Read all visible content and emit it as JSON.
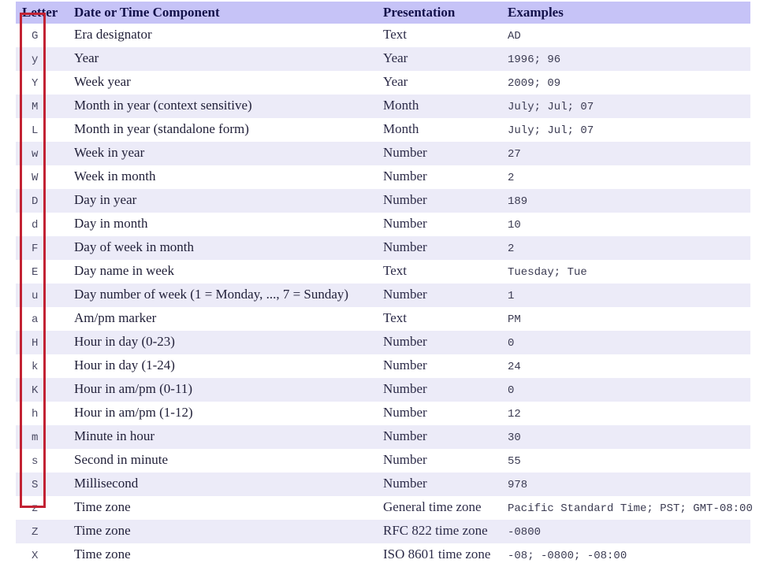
{
  "table": {
    "headers": {
      "letter": "Letter",
      "component": "Date or Time Component",
      "presentation": "Presentation",
      "examples": "Examples"
    },
    "rows": [
      {
        "letter": "G",
        "component": "Era designator",
        "presentation": "Text",
        "examples": "AD"
      },
      {
        "letter": "y",
        "component": "Year",
        "presentation": "Year",
        "examples": "1996; 96"
      },
      {
        "letter": "Y",
        "component": "Week year",
        "presentation": "Year",
        "examples": "2009; 09"
      },
      {
        "letter": "M",
        "component": "Month in year (context sensitive)",
        "presentation": "Month",
        "examples": "July; Jul; 07"
      },
      {
        "letter": "L",
        "component": "Month in year (standalone form)",
        "presentation": "Month",
        "examples": "July; Jul; 07"
      },
      {
        "letter": "w",
        "component": "Week in year",
        "presentation": "Number",
        "examples": "27"
      },
      {
        "letter": "W",
        "component": "Week in month",
        "presentation": "Number",
        "examples": "2"
      },
      {
        "letter": "D",
        "component": "Day in year",
        "presentation": "Number",
        "examples": "189"
      },
      {
        "letter": "d",
        "component": "Day in month",
        "presentation": "Number",
        "examples": "10"
      },
      {
        "letter": "F",
        "component": "Day of week in month",
        "presentation": "Number",
        "examples": "2"
      },
      {
        "letter": "E",
        "component": "Day name in week",
        "presentation": "Text",
        "examples": "Tuesday; Tue"
      },
      {
        "letter": "u",
        "component": "Day number of week (1 = Monday, ..., 7 = Sunday)",
        "presentation": "Number",
        "examples": "1"
      },
      {
        "letter": "a",
        "component": "Am/pm marker",
        "presentation": "Text",
        "examples": "PM"
      },
      {
        "letter": "H",
        "component": "Hour in day (0-23)",
        "presentation": "Number",
        "examples": "0"
      },
      {
        "letter": "k",
        "component": "Hour in day (1-24)",
        "presentation": "Number",
        "examples": "24"
      },
      {
        "letter": "K",
        "component": "Hour in am/pm (0-11)",
        "presentation": "Number",
        "examples": "0"
      },
      {
        "letter": "h",
        "component": "Hour in am/pm (1-12)",
        "presentation": "Number",
        "examples": "12"
      },
      {
        "letter": "m",
        "component": "Minute in hour",
        "presentation": "Number",
        "examples": "30"
      },
      {
        "letter": "s",
        "component": "Second in minute",
        "presentation": "Number",
        "examples": "55"
      },
      {
        "letter": "S",
        "component": "Millisecond",
        "presentation": "Number",
        "examples": "978"
      },
      {
        "letter": "z",
        "component": "Time zone",
        "presentation": "General time zone",
        "examples": "Pacific Standard Time; PST; GMT-08:00"
      },
      {
        "letter": "Z",
        "component": "Time zone",
        "presentation": "RFC 822 time zone",
        "examples": "-0800"
      },
      {
        "letter": "X",
        "component": "Time zone",
        "presentation": "ISO 8601 time zone",
        "examples": "-08; -0800; -08:00"
      }
    ]
  },
  "annotation": {
    "shape": "rectangle",
    "target_column": "Letter",
    "color": "#c22233"
  },
  "colors": {
    "header_background": "#c6c3f7",
    "row_odd_background": "#ecebf8",
    "row_even_background": "#ffffff",
    "text": "#23223b",
    "annotation": "#c22233"
  }
}
